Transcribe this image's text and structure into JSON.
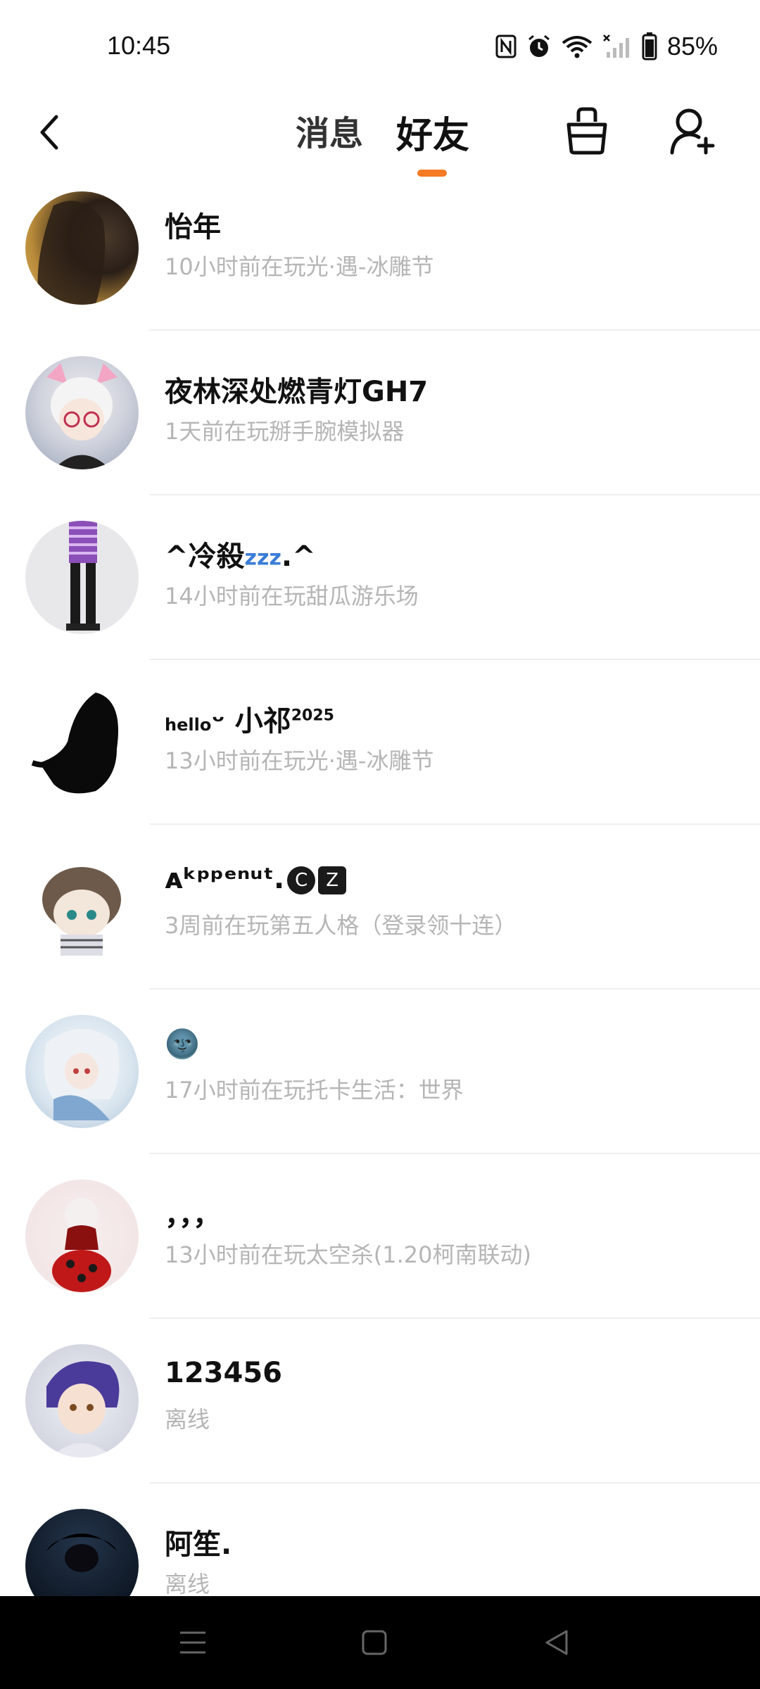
{
  "status_bar": {
    "time": "10:45",
    "battery": "85%",
    "icons": [
      "nfc-icon",
      "alarm-icon",
      "wifi-icon",
      "cellular-no-signal-icon",
      "battery-icon"
    ]
  },
  "header": {
    "tabs": [
      {
        "label": "消息",
        "active": false
      },
      {
        "label": "好友",
        "active": true
      }
    ],
    "accent_color": "#f47a24",
    "icons": [
      "back-arrow-icon",
      "cleaner-basket-icon",
      "add-friend-icon"
    ]
  },
  "friends": [
    {
      "name": "怡年",
      "status": "10小时前在玩光·遇-冰雕节"
    },
    {
      "name": "夜林深处燃青灯GH7",
      "status": "1天前在玩掰手腕模拟器"
    },
    {
      "name_prefix": "^冷殺",
      "name_mid": "zzz",
      "name_suffix": ".^",
      "status": "14小时前在玩甜瓜游乐场"
    },
    {
      "name_prefix": "hello",
      "name_mid": "ᵕ 小祁",
      "name_sup": "2025",
      "status": "13小时前在玩光·遇-冰雕节"
    },
    {
      "name_prefix": "ᴀᵏᵖᵖᵉⁿᵘᵗ.",
      "badge1": "C",
      "badge2": "Z",
      "status": "3周前在玩第五人格（登录领十连）"
    },
    {
      "name": "🌚",
      "status": "17小时前在玩托卡生活：世界"
    },
    {
      "name": "，，，",
      "status": "13小时前在玩太空杀(1.20柯南联动)"
    },
    {
      "name": "123456",
      "status": "离线"
    },
    {
      "name": "阿笙.",
      "status": "离线"
    }
  ],
  "colors": {
    "status_text": "#b5b5b5",
    "divider": "#efefef",
    "nav_bar": "#000000"
  }
}
